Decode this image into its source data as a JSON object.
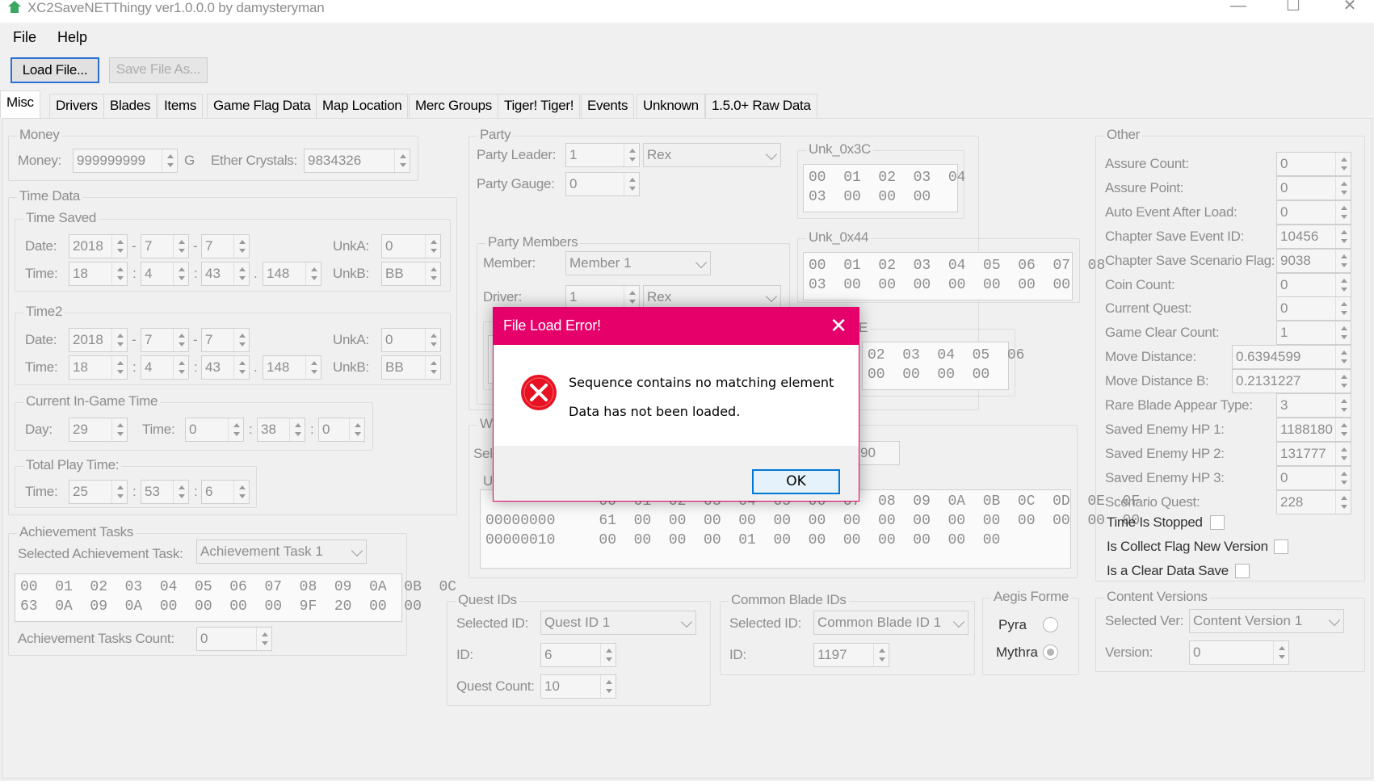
{
  "window": {
    "title": "XC2SaveNETThingy ver1.0.0.0 by damysteryman",
    "minimize": "—",
    "maximize": "☐",
    "close": "✕"
  },
  "menu": {
    "file": "File",
    "help": "Help"
  },
  "toolbar": {
    "load": "Load File...",
    "save": "Save File As..."
  },
  "tabs": [
    "Misc",
    "Drivers",
    "Blades",
    "Items",
    "Game Flag Data",
    "Map Location",
    "Merc Groups",
    "Tiger! Tiger!",
    "Events",
    "Unknown",
    "1.5.0+ Raw Data"
  ],
  "money": {
    "group": "Money",
    "money_label": "Money:",
    "money_value": "999999999",
    "currency": "G",
    "ether_label": "Ether Crystals:",
    "ether_value": "9834326"
  },
  "time_data": {
    "group": "Time Data",
    "time_saved": {
      "group": "Time Saved",
      "date_label": "Date:",
      "year": "2018",
      "month": "7",
      "day": "7",
      "time_label": "Time:",
      "hour": "18",
      "minute": "4",
      "second": "43",
      "ms": "148",
      "unka_label": "UnkA:",
      "unka": "0",
      "unkb_label": "UnkB:",
      "unkb": "BB"
    },
    "time2": {
      "group": "Time2",
      "date_label": "Date:",
      "year": "2018",
      "month": "7",
      "day": "7",
      "time_label": "Time:",
      "hour": "18",
      "minute": "4",
      "second": "43",
      "ms": "148",
      "unka_label": "UnkA:",
      "unka": "0",
      "unkb_label": "UnkB:",
      "unkb": "BB"
    },
    "ingame": {
      "group": "Current In-Game Time",
      "day_label": "Day:",
      "day": "29",
      "time_label": "Time:",
      "hour": "0",
      "minute": "38",
      "second": "0"
    },
    "playtime": {
      "group": "Total Play Time:",
      "time_label": "Time:",
      "hour": "25",
      "minute": "53",
      "second": "6"
    },
    "dash": "-",
    "colon": ":",
    "dot": "."
  },
  "achievement": {
    "group": "Achievement Tasks",
    "selected_label": "Selected Achievement Task:",
    "selected": "Achievement Task 1",
    "hex": "00  01  02  03  04  05  06  07  08  09  0A  0B  0C\n63  0A  09  0A  00  00  00  00  9F  20  00  00",
    "count_label": "Achievement Tasks Count:",
    "count": "0"
  },
  "party": {
    "group": "Party",
    "leader_label": "Party Leader:",
    "leader_id": "1",
    "leader_name": "Rex",
    "gauge_label": "Party Gauge:",
    "gauge": "0",
    "unk3c_group": "Unk_0x3C",
    "unk3c_hex": "00  01  02  03  04\n03  00  00  00",
    "members_group": "Party Members",
    "member_label": "Member:",
    "member": "Member 1",
    "driver_label": "Driver:",
    "driver_id": "1",
    "driver_name": "Rex",
    "unk44_group": "Unk_0x44",
    "unk44_hex": "00  01  02  03  04  05  06  07  08\n03  00  00  00  00  00  00  00",
    "unk_partial_group": "E",
    "unk_partial_hex": "02  03  04  05  06\n00  00  00  00",
    "weather_partial": "We",
    "select_partial": "Sele",
    "select_value_partial": "90",
    "u_partial": "U",
    "raw_hex": "             00  01  02  03  04  05  06  07  08  09  0A  0B  0C  0D  0E  0F\n00000000     61  00  00  00  00  00  00  00  00  00  00  00  00  00  00  00\n00000010     00  00  00  00  01  00  00  00  00  00  00  00"
  },
  "quest": {
    "group": "Quest IDs",
    "selected_label": "Selected ID:",
    "selected": "Quest ID 1",
    "id_label": "ID:",
    "id": "6",
    "count_label": "Quest Count:",
    "count": "10"
  },
  "common_blade": {
    "group": "Common Blade IDs",
    "selected_label": "Selected ID:",
    "selected": "Common Blade ID 1",
    "id_label": "ID:",
    "id": "1197"
  },
  "aegis": {
    "group": "Aegis Forme",
    "pyra": "Pyra",
    "mythra": "Mythra",
    "selected": "Mythra"
  },
  "other": {
    "group": "Other",
    "fields": [
      {
        "label": "Assure Count:",
        "value": "0"
      },
      {
        "label": "Assure Point:",
        "value": "0"
      },
      {
        "label": "Auto Event After Load:",
        "value": "0"
      },
      {
        "label": "Chapter Save Event ID:",
        "value": "10456"
      },
      {
        "label": "Chapter Save Scenario Flag:",
        "value": "9038"
      },
      {
        "label": "Coin Count:",
        "value": "0"
      },
      {
        "label": "Current Quest:",
        "value": "0"
      },
      {
        "label": "Game Clear Count:",
        "value": "1"
      },
      {
        "label": "Move Distance:",
        "value": "0.6394599"
      },
      {
        "label": "Move Distance B:",
        "value": "0.2131227"
      },
      {
        "label": "Rare Blade Appear Type:",
        "value": "3"
      },
      {
        "label": "Saved Enemy HP 1:",
        "value": "1188180"
      },
      {
        "label": "Saved Enemy HP 2:",
        "value": "131777"
      },
      {
        "label": "Saved Enemy HP 3:",
        "value": "0"
      },
      {
        "label": "Scenario Quest:",
        "value": "228"
      }
    ],
    "checks": [
      {
        "label": "Time Is Stopped",
        "checked": false
      },
      {
        "label": "Is Collect Flag New Version",
        "checked": false
      },
      {
        "label": "Is a Clear Data Save",
        "checked": false
      }
    ]
  },
  "content_versions": {
    "group": "Content Versions",
    "selected_label": "Selected Ver:",
    "selected": "Content Version 1",
    "version_label": "Version:",
    "version": "0"
  },
  "dialog": {
    "title": "File Load Error!",
    "close": "✕",
    "line1": "Sequence contains no matching element",
    "line2": "Data has not been loaded.",
    "ok": "OK",
    "icon_glyph": "✕",
    "accent": "#e5006a",
    "error_color": "#e81123"
  }
}
